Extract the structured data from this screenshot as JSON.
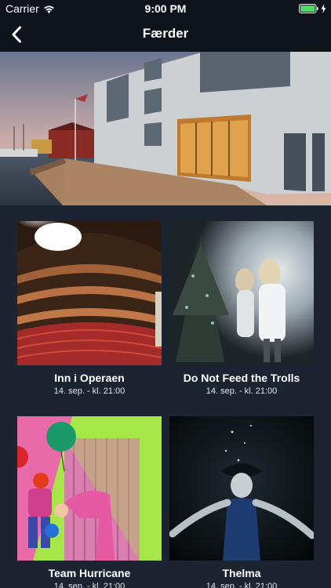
{
  "status_bar": {
    "carrier": "Carrier",
    "time": "9:00 PM",
    "battery_color": "#4cd964"
  },
  "nav": {
    "title": "Færder",
    "back_icon": "chevron-left-icon"
  },
  "colors": {
    "background": "#1c2431",
    "bar": "#0f141c"
  },
  "events": [
    {
      "title": "Inn i Operaen",
      "date": "14. sep. - kl. 21:00"
    },
    {
      "title": "Do Not Feed the Trolls",
      "date": "14. sep. - kl. 21:00"
    },
    {
      "title": "Team Hurricane",
      "date": "14. sep. - kl. 21:00"
    },
    {
      "title": "Thelma",
      "date": "14. sep. - kl. 21:00"
    }
  ]
}
